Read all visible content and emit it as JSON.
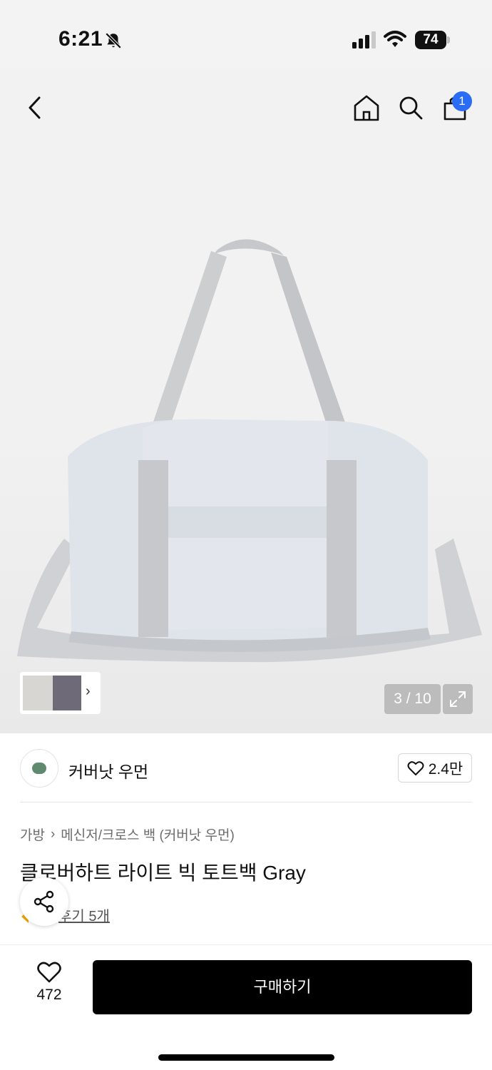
{
  "status_bar": {
    "time": "6:21",
    "battery": "74"
  },
  "header": {
    "cart_count": "1"
  },
  "gallery": {
    "counter": "3 / 10"
  },
  "brand": {
    "name": "커버낫 우먼",
    "likes": "2.4만"
  },
  "breadcrumb": {
    "items": [
      "가방",
      "메신저/크로스 백 (커버낫 우먼)"
    ]
  },
  "product": {
    "title": "클로버하트 라이트 빅 토트백 Gray",
    "review_text": "후기 5개"
  },
  "bottom_bar": {
    "wish_count": "472",
    "buy_label": "구매하기"
  },
  "colors": {
    "accent": "#2b6cf6",
    "buy_button": "#000000"
  }
}
